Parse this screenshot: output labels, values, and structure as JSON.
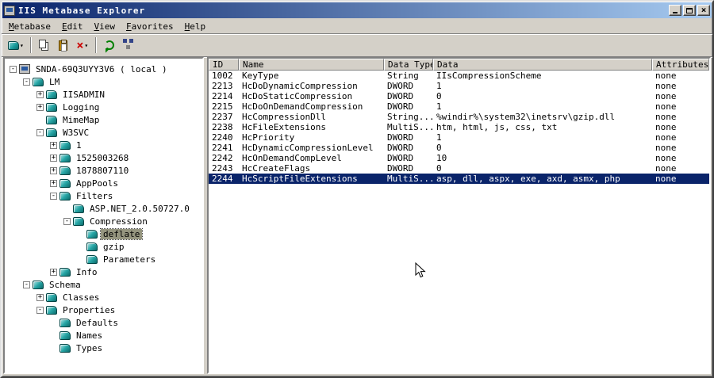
{
  "colors": {
    "titlebar_start": "#0a246a",
    "titlebar_end": "#a6caf0",
    "window_face": "#d4d0c8",
    "selection": "#0a246a"
  },
  "window": {
    "title": "IIS Metabase Explorer"
  },
  "menu": {
    "items": [
      {
        "label": "Metabase"
      },
      {
        "label": "Edit"
      },
      {
        "label": "View"
      },
      {
        "label": "Favorites"
      },
      {
        "label": "Help"
      }
    ]
  },
  "toolbar": {
    "items": [
      {
        "name": "new-key",
        "icon": "new-key",
        "dropdown": true
      },
      {
        "type": "separator"
      },
      {
        "name": "copy",
        "icon": "copy",
        "dropdown": false
      },
      {
        "name": "paste",
        "icon": "paste",
        "dropdown": false
      },
      {
        "name": "delete",
        "icon": "delete",
        "dropdown": true
      },
      {
        "type": "separator"
      },
      {
        "name": "refresh",
        "icon": "refresh",
        "dropdown": false
      },
      {
        "name": "connect",
        "icon": "network",
        "dropdown": false
      }
    ]
  },
  "tree": {
    "items": [
      {
        "label": "SNDA-69Q3UYY3V6 ( local )",
        "level": 0,
        "expand": "-",
        "icon": "server",
        "selected": false
      },
      {
        "label": "LM",
        "level": 1,
        "expand": "-",
        "icon": "key",
        "selected": false
      },
      {
        "label": "IISADMIN",
        "level": 2,
        "expand": "+",
        "icon": "key",
        "selected": false
      },
      {
        "label": "Logging",
        "level": 2,
        "expand": "+",
        "icon": "key",
        "selected": false
      },
      {
        "label": "MimeMap",
        "level": 2,
        "expand": "",
        "icon": "key",
        "selected": false
      },
      {
        "label": "W3SVC",
        "level": 2,
        "expand": "-",
        "icon": "key",
        "selected": false
      },
      {
        "label": "1",
        "level": 3,
        "expand": "+",
        "icon": "key",
        "selected": false
      },
      {
        "label": "1525003268",
        "level": 3,
        "expand": "+",
        "icon": "key",
        "selected": false
      },
      {
        "label": "1878807110",
        "level": 3,
        "expand": "+",
        "icon": "key",
        "selected": false
      },
      {
        "label": "AppPools",
        "level": 3,
        "expand": "+",
        "icon": "key",
        "selected": false
      },
      {
        "label": "Filters",
        "level": 3,
        "expand": "-",
        "icon": "key",
        "selected": false
      },
      {
        "label": "ASP.NET_2.0.50727.0",
        "level": 4,
        "expand": "",
        "icon": "key",
        "selected": false
      },
      {
        "label": "Compression",
        "level": 4,
        "expand": "-",
        "icon": "key",
        "selected": false
      },
      {
        "label": "deflate",
        "level": 5,
        "expand": "",
        "icon": "key",
        "selected": true
      },
      {
        "label": "gzip",
        "level": 5,
        "expand": "",
        "icon": "key",
        "selected": false
      },
      {
        "label": "Parameters",
        "level": 5,
        "expand": "",
        "icon": "key",
        "selected": false
      },
      {
        "label": "Info",
        "level": 3,
        "expand": "+",
        "icon": "key",
        "selected": false
      },
      {
        "label": "Schema",
        "level": 1,
        "expand": "-",
        "icon": "key",
        "selected": false
      },
      {
        "label": "Classes",
        "level": 2,
        "expand": "+",
        "icon": "key",
        "selected": false
      },
      {
        "label": "Properties",
        "level": 2,
        "expand": "-",
        "icon": "key",
        "selected": false
      },
      {
        "label": "Defaults",
        "level": 3,
        "expand": "",
        "icon": "key",
        "selected": false
      },
      {
        "label": "Names",
        "level": 3,
        "expand": "",
        "icon": "key",
        "selected": false
      },
      {
        "label": "Types",
        "level": 3,
        "expand": "",
        "icon": "key",
        "selected": false
      }
    ]
  },
  "list": {
    "columns": [
      "ID",
      "Name",
      "Data Type",
      "Data",
      "Attributes"
    ],
    "rows": [
      {
        "id": "1002",
        "name": "KeyType",
        "type": "String",
        "data": "IIsCompressionScheme",
        "attributes": "none",
        "selected": false
      },
      {
        "id": "2213",
        "name": "HcDoDynamicCompression",
        "type": "DWORD",
        "data": "1",
        "attributes": "none",
        "selected": false
      },
      {
        "id": "2214",
        "name": "HcDoStaticCompression",
        "type": "DWORD",
        "data": "0",
        "attributes": "none",
        "selected": false
      },
      {
        "id": "2215",
        "name": "HcDoOnDemandCompression",
        "type": "DWORD",
        "data": "1",
        "attributes": "none",
        "selected": false
      },
      {
        "id": "2237",
        "name": "HcCompressionDll",
        "type": "String...",
        "data": "%windir%\\system32\\inetsrv\\gzip.dll",
        "attributes": "none",
        "selected": false
      },
      {
        "id": "2238",
        "name": "HcFileExtensions",
        "type": "MultiS...",
        "data": "htm, html, js, css, txt",
        "attributes": "none",
        "selected": false
      },
      {
        "id": "2240",
        "name": "HcPriority",
        "type": "DWORD",
        "data": "1",
        "attributes": "none",
        "selected": false
      },
      {
        "id": "2241",
        "name": "HcDynamicCompressionLevel",
        "type": "DWORD",
        "data": "0",
        "attributes": "none",
        "selected": false
      },
      {
        "id": "2242",
        "name": "HcOnDemandCompLevel",
        "type": "DWORD",
        "data": "10",
        "attributes": "none",
        "selected": false
      },
      {
        "id": "2243",
        "name": "HcCreateFlags",
        "type": "DWORD",
        "data": "0",
        "attributes": "none",
        "selected": false
      },
      {
        "id": "2244",
        "name": "HcScriptFileExtensions",
        "type": "MultiS...",
        "data": "asp, dll, aspx, exe, axd, asmx, php",
        "attributes": "none",
        "selected": true
      }
    ]
  }
}
